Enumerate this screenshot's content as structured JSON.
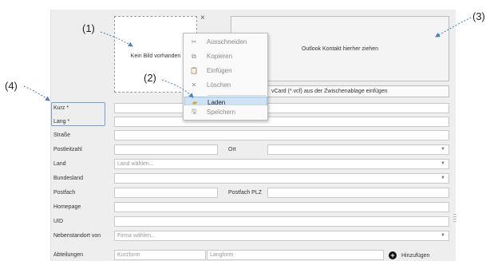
{
  "photo": {
    "placeholder": "Kein Bild vorhanden",
    "close_glyph": "×"
  },
  "outlook": {
    "drop_text": "Outlook Kontakt hierher ziehen"
  },
  "vcard": {
    "text": "vCard (*.vcf) aus der Zwischenablage einfügen"
  },
  "context_menu": {
    "items": [
      {
        "label": "Ausschneiden",
        "icon": "scissors-icon",
        "glyph": "✂"
      },
      {
        "label": "Kopieren",
        "icon": "copy-icon",
        "glyph": "⧉"
      },
      {
        "label": "Einfügen",
        "icon": "paste-icon",
        "glyph": "📋"
      },
      {
        "label": "Löschen",
        "icon": "delete-icon",
        "glyph": "✕"
      },
      {
        "label": "Laden",
        "icon": "folder-icon",
        "glyph": "▰",
        "highlighted": true
      },
      {
        "label": "Speichern",
        "icon": "save-icon",
        "glyph": "🖫"
      }
    ]
  },
  "annotations": {
    "a1": "(1)",
    "a2": "(2)",
    "a3": "(3)",
    "a4": "(4)"
  },
  "form": {
    "kurz_label": "Kurz *",
    "lang_label": "Lang *",
    "strasse_label": "Straße",
    "plz_label": "Postleitzahl",
    "ort_label": "Ort",
    "land_label": "Land",
    "land_placeholder": "Land wählen...",
    "bundesland_label": "Bundesland",
    "postfach_label": "Postfach",
    "postfach_plz_label": "Postfach PLZ",
    "homepage_label": "Homepage",
    "uid_label": "UID",
    "nebenstandort_label": "Nebenstandort von",
    "firma_placeholder": "Firma wählen...",
    "abteilungen_label": "Abteilungen",
    "kurzform_placeholder": "Kurzform",
    "langform_placeholder": "Langform",
    "add_label": "Hinzufügen"
  },
  "colors": {
    "highlight": "#cfe3f7",
    "required_border": "#6fa0d8",
    "panel": "#eeeeee"
  }
}
